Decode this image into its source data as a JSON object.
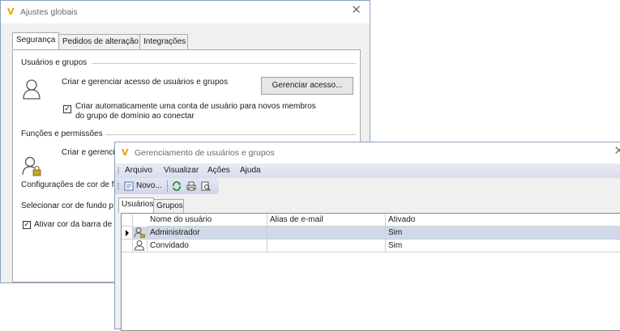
{
  "win1": {
    "title": "Ajustes globais",
    "close_glyph": "✕",
    "tabs": [
      {
        "label": "Segurança",
        "active": true
      },
      {
        "label": "Pedidos de alteração",
        "active": false
      },
      {
        "label": "Integrações",
        "active": false
      }
    ],
    "users_section": {
      "heading": "Usuários e grupos",
      "description": "Criar e gerenciar acesso de usuários e grupos",
      "manage_button": "Gerenciar acesso...",
      "auto_create_line1": "Criar automaticamente uma conta de usuário para novos membros",
      "auto_create_line2": "do grupo de domínio ao conectar",
      "auto_create_checked": true
    },
    "roles_section": {
      "heading": "Funções e permissões",
      "description": "Criar e gerenci"
    },
    "color_config_label": "Configurações de cor de f",
    "bg_color_label": "Selecionar cor de fundo p",
    "activate_bar_label": "Ativar cor da barra de",
    "activate_bar_checked": true
  },
  "win2": {
    "title": "Gerenciamento de usuários e grupos",
    "close_glyph": "✕",
    "menu": [
      "Arquivo",
      "Visualizar",
      "Ações",
      "Ajuda"
    ],
    "toolbar": {
      "new_label": "Novo...",
      "icons": [
        "new-icon",
        "refresh-icon",
        "print-icon",
        "print-preview-icon"
      ]
    },
    "tabs": [
      {
        "label": "Usuários",
        "active": true
      },
      {
        "label": "Grupos",
        "active": false
      }
    ],
    "grid": {
      "columns": [
        "Nome do usuário",
        "Alias de e-mail",
        "Ativado"
      ],
      "rows": [
        {
          "name": "Administrador",
          "alias": "",
          "active": "Sim",
          "selected": true,
          "icon": "admin-user-icon"
        },
        {
          "name": "Convidado",
          "alias": "",
          "active": "Sim",
          "selected": false,
          "icon": "guest-user-icon"
        }
      ]
    }
  },
  "colors": {
    "accent_logo": "#f0a000",
    "selected_row": "#cfd9e8",
    "menubar": "#dde1ef"
  }
}
